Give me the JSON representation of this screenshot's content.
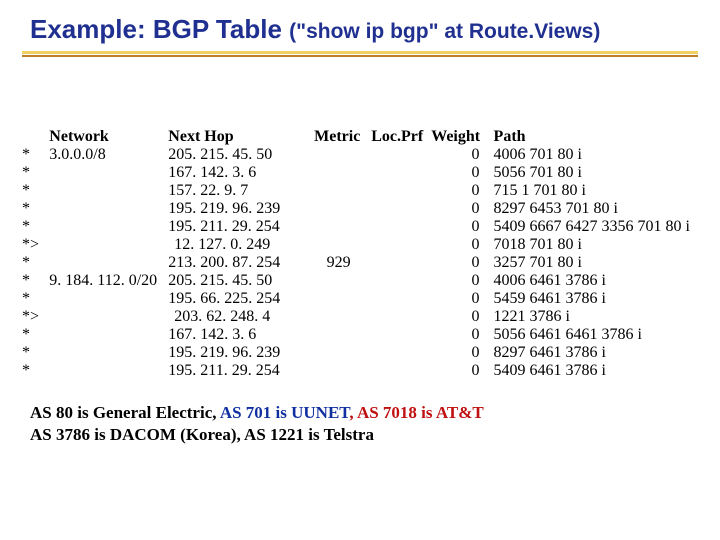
{
  "title": {
    "main": "Example: BGP Table",
    "sub": "(\"show ip bgp\" at Route.Views)"
  },
  "columns": {
    "network": "Network",
    "nexthop": "Next Hop",
    "metric": "Metric",
    "locprf": "Loc.Prf",
    "weight": "Weight",
    "path": "Path"
  },
  "rows": [
    {
      "mark": "*",
      "network": "3.0.0.0/8",
      "nexthop": "205. 215. 45. 50",
      "metric": "",
      "locprf": "",
      "weight": "0",
      "path": "4006 701 80 i",
      "indent": false
    },
    {
      "mark": "*",
      "network": "",
      "nexthop": "167. 142. 3. 6",
      "metric": "",
      "locprf": "",
      "weight": "0",
      "path": "5056 701 80 i",
      "indent": false
    },
    {
      "mark": "*",
      "network": "",
      "nexthop": "157. 22. 9. 7",
      "metric": "",
      "locprf": "",
      "weight": "0",
      "path": "715 1 701 80 i",
      "indent": false
    },
    {
      "mark": "*",
      "network": "",
      "nexthop": "195. 219. 96. 239",
      "metric": "",
      "locprf": "",
      "weight": "0",
      "path": "8297 6453 701 80 i",
      "indent": false
    },
    {
      "mark": "*",
      "network": "",
      "nexthop": "195. 211. 29. 254",
      "metric": "",
      "locprf": "",
      "weight": "0",
      "path": "5409 6667 6427 3356 701 80 i",
      "indent": false
    },
    {
      "mark": "*>",
      "network": "",
      "nexthop": "12. 127. 0. 249",
      "metric": "",
      "locprf": "",
      "weight": "0",
      "path": " 7018 701 80 i",
      "indent": true
    },
    {
      "mark": "*",
      "network": "",
      "nexthop": "213. 200. 87. 254",
      "metric": "929",
      "locprf": "",
      "weight": "0",
      "path": "3257 701 80 i",
      "indent": false
    },
    {
      "mark": "*",
      "network": "9. 184. 112. 0/20",
      "nexthop": "205. 215. 45. 50",
      "metric": "",
      "locprf": "",
      "weight": "0",
      "path": "4006 6461 3786 i",
      "indent": false
    },
    {
      "mark": "*",
      "network": "",
      "nexthop": "195. 66. 225. 254",
      "metric": "",
      "locprf": "",
      "weight": "0",
      "path": "5459 6461 3786 i",
      "indent": false
    },
    {
      "mark": "*>",
      "network": "",
      "nexthop": "203. 62. 248. 4",
      "metric": "",
      "locprf": "",
      "weight": "0",
      "path": " 1221 3786 i",
      "indent": true
    },
    {
      "mark": "*",
      "network": "",
      "nexthop": "167. 142. 3. 6",
      "metric": "",
      "locprf": "",
      "weight": "0",
      "path": "5056 6461 6461 3786 i",
      "indent": false
    },
    {
      "mark": "*",
      "network": "",
      "nexthop": "195. 219. 96. 239",
      "metric": "",
      "locprf": "",
      "weight": "0",
      "path": "8297 6461 3786 i",
      "indent": false
    },
    {
      "mark": "*",
      "network": "",
      "nexthop": "195. 211. 29. 254",
      "metric": "",
      "locprf": "",
      "weight": "0",
      "path": "5409 6461 3786 i",
      "indent": false
    }
  ],
  "footer": {
    "ge_label": "AS 80 is General Electric, ",
    "uunet_label": "AS 701 is UUNET",
    "att_label": ", AS 7018 is AT&T",
    "line2": "AS 3786 is DACOM (Korea), AS 1221 is Telstra"
  }
}
